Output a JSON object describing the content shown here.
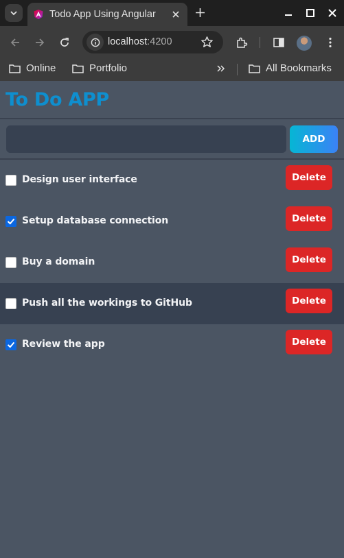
{
  "browser": {
    "tab_title": "Todo App Using Angular",
    "url_host": "localhost",
    "url_port": ":4200",
    "bookmarks": [
      "Online",
      "Portfolio"
    ],
    "all_bookmarks_label": "All Bookmarks"
  },
  "app": {
    "title": "To Do APP",
    "input": {
      "value": "",
      "placeholder": ""
    },
    "add_label": "ADD",
    "delete_label": "Delete",
    "todos": [
      {
        "text": "Design user interface",
        "done": false
      },
      {
        "text": "Setup database connection",
        "done": true
      },
      {
        "text": "Buy a domain",
        "done": false
      },
      {
        "text": "Push all the workings to GitHub",
        "done": false
      },
      {
        "text": "Review the app",
        "done": true
      }
    ]
  },
  "colors": {
    "title": "#0e8fcf",
    "background": "#4b5563",
    "delete": "#dc2626",
    "add_gradient_start": "#06b6d4",
    "add_gradient_end": "#3b82f6",
    "checkbox_checked": "#0b67e0"
  }
}
